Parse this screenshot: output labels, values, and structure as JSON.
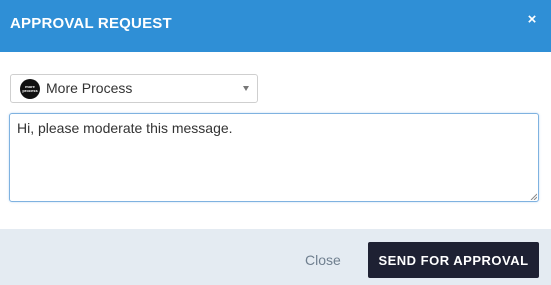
{
  "dialog": {
    "title": "APPROVAL REQUEST",
    "close_icon": "×"
  },
  "process_select": {
    "logo_line1": "more",
    "logo_line2": "process",
    "selected": "More Process"
  },
  "message": {
    "value": "Hi, please moderate this message."
  },
  "footer": {
    "close_label": "Close",
    "send_label": "SEND FOR APPROVAL"
  },
  "colors": {
    "header_bg": "#2f8fd6",
    "footer_bg": "#e4ebf2",
    "primary_button": "#1e2133"
  },
  "icons": [
    "close-icon",
    "process-logo-icon",
    "chevron-down-icon",
    "resize-grip-icon"
  ]
}
